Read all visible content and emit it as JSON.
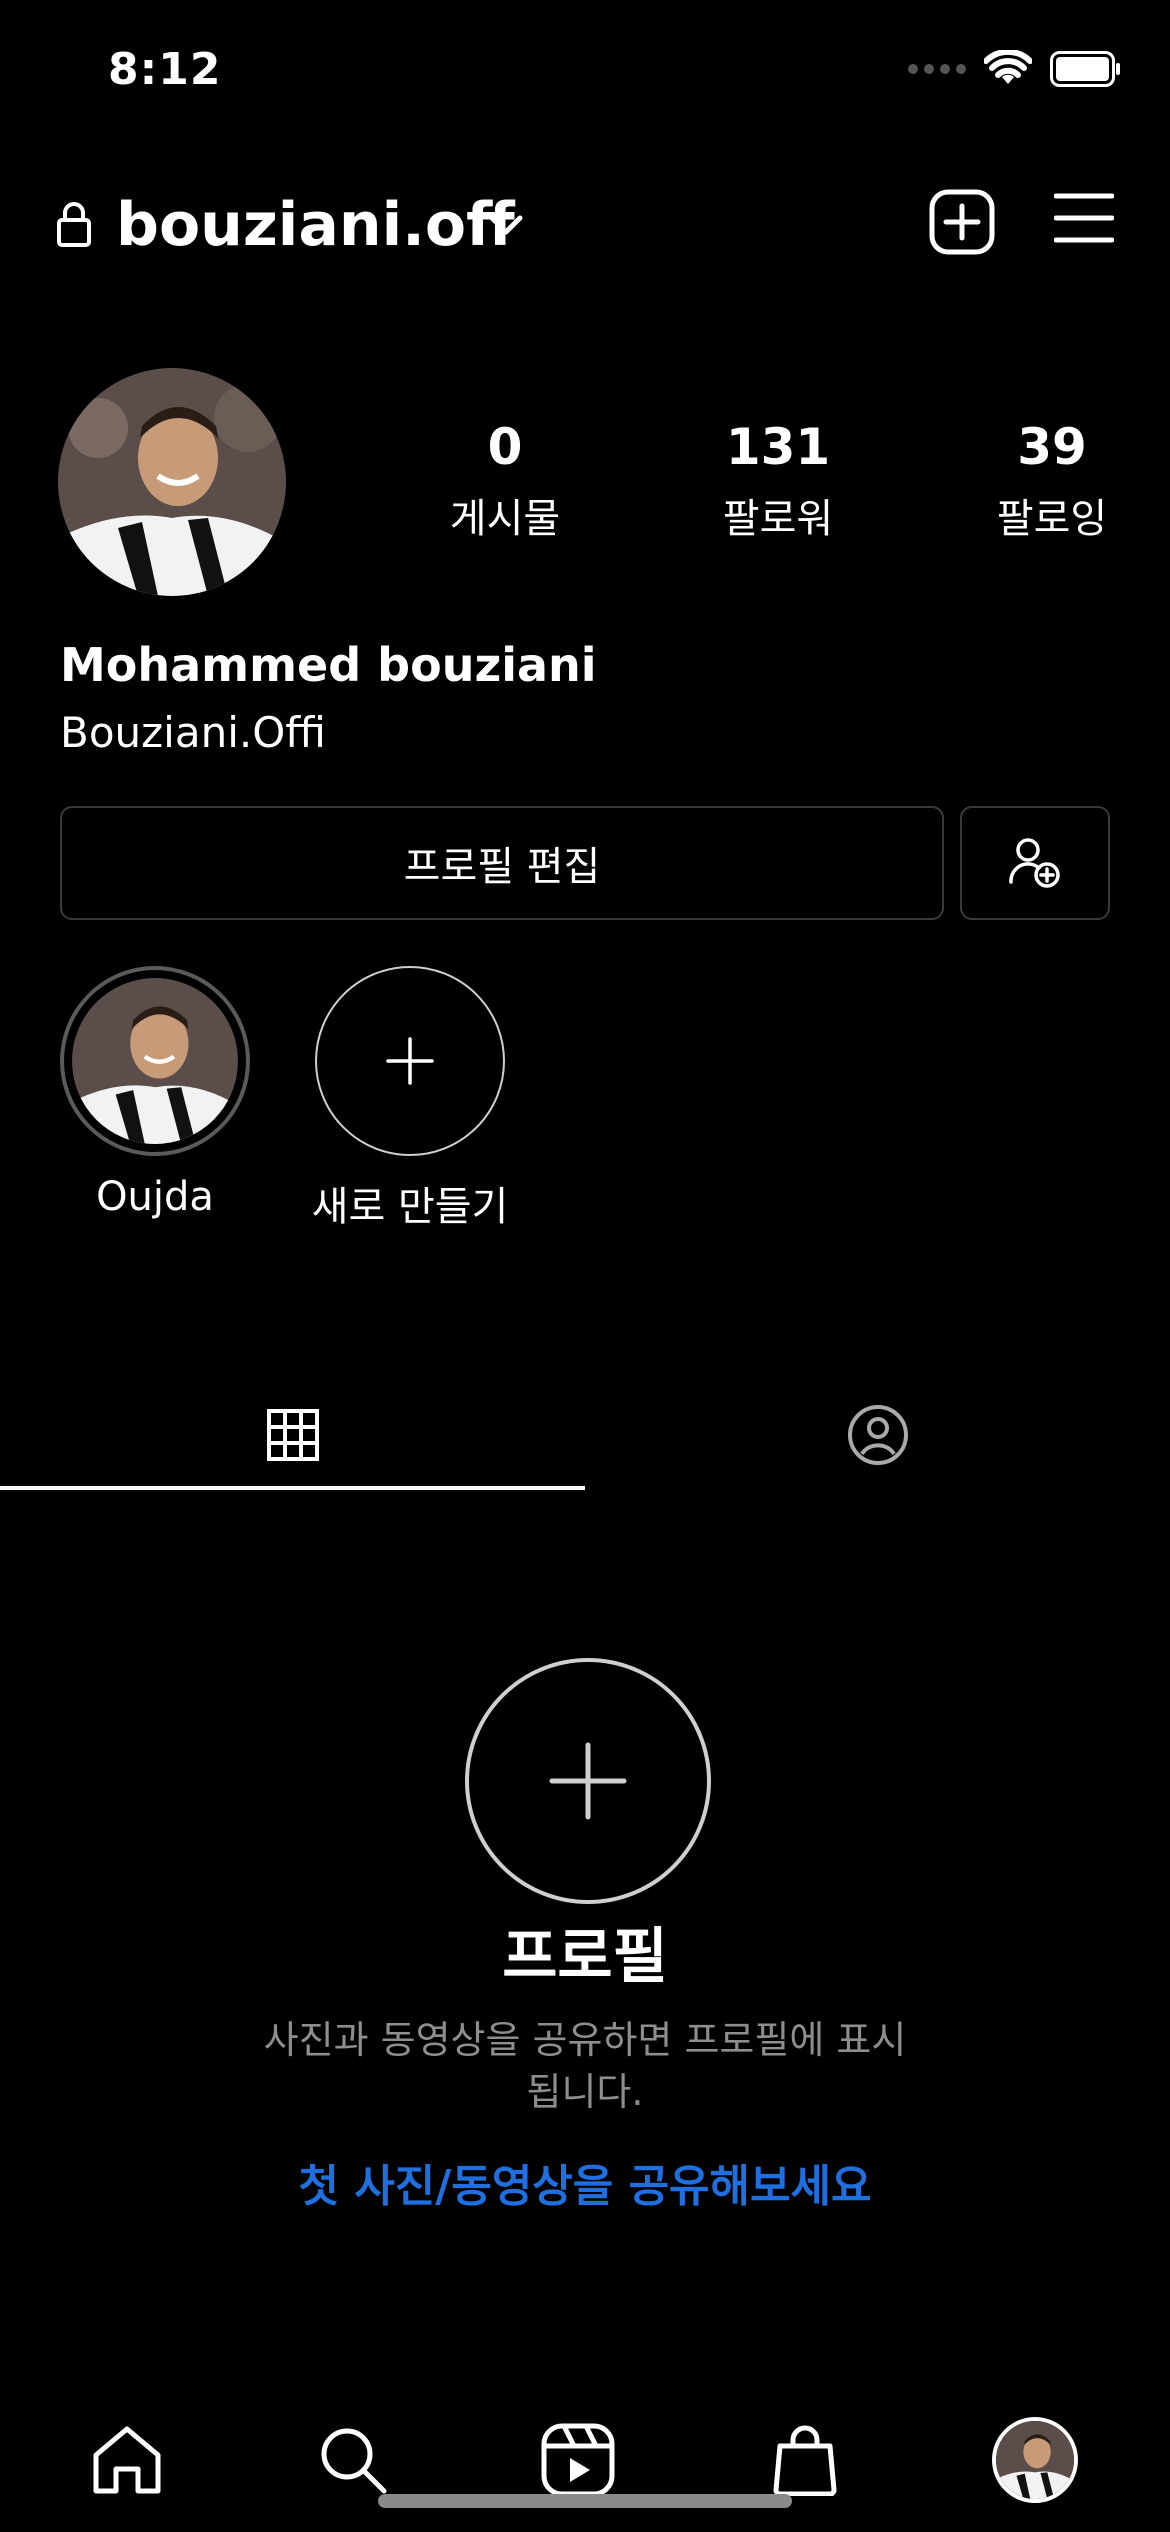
{
  "status_bar": {
    "time": "8:12"
  },
  "header": {
    "username": "bouziani.off"
  },
  "profile": {
    "stats": [
      {
        "value": "0",
        "label": "게시물"
      },
      {
        "value": "131",
        "label": "팔로워"
      },
      {
        "value": "39",
        "label": "팔로잉"
      }
    ],
    "display_name": "Mohammed bouziani",
    "handle": "Bouziani.Offi",
    "edit_button": "프로필 편집"
  },
  "highlights": [
    {
      "label": "Oujda"
    },
    {
      "label": "새로 만들기"
    }
  ],
  "tabs": [
    {
      "icon": "grid-icon",
      "active": true
    },
    {
      "icon": "tagged-icon",
      "active": false
    }
  ],
  "empty_state": {
    "title": "프로필",
    "description": "사진과 동영상을 공유하면 프로필에 표시됩니다.",
    "link": "첫 사진/동영상을 공유해보세요"
  },
  "bottom_nav": [
    "home-icon",
    "search-icon",
    "reels-icon",
    "shop-icon",
    "profile-avatar"
  ],
  "colors": {
    "background": "#000000",
    "accent_link": "#1f6fe0",
    "muted_text": "#8e8e8e"
  }
}
